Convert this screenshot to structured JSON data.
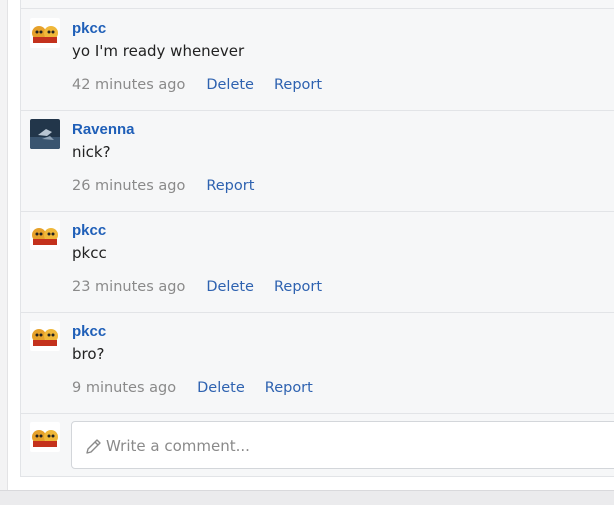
{
  "comments": [
    {
      "author": "pkcc",
      "text": "yo I'm ready whenever",
      "time": "42 minutes ago",
      "delete_label": "Delete",
      "report_label": "Report",
      "avatar": "pkcc-avatar"
    },
    {
      "author": "Ravenna",
      "text": "nick?",
      "time": "26 minutes ago",
      "report_label": "Report",
      "avatar": "ravenna-avatar"
    },
    {
      "author": "pkcc",
      "text": "pkcc",
      "time": "23 minutes ago",
      "delete_label": "Delete",
      "report_label": "Report",
      "avatar": "pkcc-avatar"
    },
    {
      "author": "pkcc",
      "text": "bro?",
      "time": "9 minutes ago",
      "delete_label": "Delete",
      "report_label": "Report",
      "avatar": "pkcc-avatar"
    }
  ],
  "composer": {
    "placeholder": "Write a comment...",
    "icon": "pencil-icon"
  },
  "colors": {
    "author": "#1f5fb8",
    "link": "#2e62b0",
    "muted": "#8a8a8a",
    "panel": "#f6f7f8"
  }
}
